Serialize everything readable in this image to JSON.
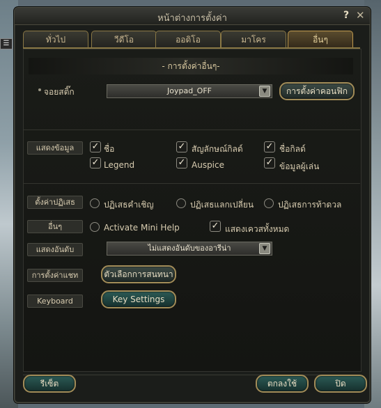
{
  "window": {
    "title": "หน้าต่างการตั้งค่า",
    "help_glyph": "?",
    "close_glyph": "✕"
  },
  "tabs": [
    {
      "label": "ทั่วไป",
      "active": false
    },
    {
      "label": "วีดีโอ",
      "active": false
    },
    {
      "label": "ออดิโอ",
      "active": false
    },
    {
      "label": "มาโคร",
      "active": false
    },
    {
      "label": "อื่นๆ",
      "active": true
    }
  ],
  "section_header": "- การตั้งค่าอื่นๆ-",
  "joystick": {
    "label": "จอยสติ๊ก",
    "value": "Joypad_OFF",
    "config_button": "การตั้งค่าคอนฟิก"
  },
  "display_info": {
    "label": "แสดงข้อมูล",
    "options": [
      {
        "label": "ชื่อ",
        "checked": true
      },
      {
        "label": "สัญลักษณ์กิลด์",
        "checked": true
      },
      {
        "label": "ชื่อกิลด์",
        "checked": true
      },
      {
        "label": "Legend",
        "checked": true
      },
      {
        "label": "Auspice",
        "checked": true
      },
      {
        "label": "ข้อมูลผู้เล่น",
        "checked": true
      }
    ]
  },
  "reject": {
    "label": "ตั้งค่าปฏิเสธ",
    "options": [
      {
        "label": "ปฏิเสธคำเชิญ",
        "selected": false
      },
      {
        "label": "ปฏิเสธแลกเปลี่ยน",
        "selected": false
      },
      {
        "label": "ปฏิเสธการท้าดวล",
        "selected": false
      }
    ]
  },
  "other": {
    "label": "อื่นๆ",
    "options": [
      {
        "label": "Activate  Mini  Help",
        "checked": false
      },
      {
        "label": "แสดงเควสทั้งหมด",
        "checked": true
      }
    ]
  },
  "ranking": {
    "label": "แสดงอันดับ",
    "value": "ไม่แสดงอันดับของอารีน่า"
  },
  "chat": {
    "label": "การตั้งค่าแชท",
    "button": "ตัวเลือกการสนทนา"
  },
  "keyboard": {
    "label": "Keyboard",
    "button": "Key  Settings"
  },
  "footer": {
    "reset": "รีเซ็ต",
    "ok": "ตกลงใช้",
    "close": "ปิด"
  },
  "side_tab": "☰"
}
